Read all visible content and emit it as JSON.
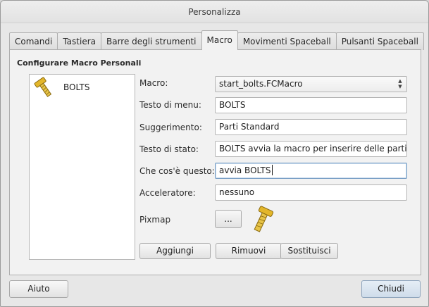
{
  "window": {
    "title": "Personalizza"
  },
  "tabs": [
    {
      "label": "Comandi"
    },
    {
      "label": "Tastiera"
    },
    {
      "label": "Barre degli strumenti"
    },
    {
      "label": "Macro",
      "active": true
    },
    {
      "label": "Movimenti Spaceball"
    },
    {
      "label": "Pulsanti Spaceball"
    }
  ],
  "macro_panel": {
    "group_title": "Configurare Macro Personali",
    "list": [
      {
        "label": "BOLTS",
        "icon": "bolt-icon"
      }
    ],
    "form": {
      "macro_label": "Macro:",
      "macro_value": "start_bolts.FCMacro",
      "menu_text_label": "Testo di menu:",
      "menu_text_value": "BOLTS",
      "tooltip_label": "Suggerimento:",
      "tooltip_value": "Parti Standard",
      "status_text_label": "Testo di stato:",
      "status_text_value": "BOLTS avvia la macro per inserire delle parti st",
      "whats_this_label": "Che cos'è questo:",
      "whats_this_value": "avvia BOLTS",
      "accelerator_label": "Acceleratore:",
      "accelerator_value": "nessuno",
      "pixmap_label": "Pixmap",
      "pixmap_button": "...",
      "pixmap_icon": "bolt-icon"
    },
    "buttons": {
      "add": "Aggiungi",
      "remove": "Rimuovi",
      "replace": "Sostituisci"
    }
  },
  "footer": {
    "help": "Aiuto",
    "close": "Chiudi"
  },
  "colors": {
    "accent": "#cfdcea",
    "bolt_gold": "#e3b62a"
  }
}
